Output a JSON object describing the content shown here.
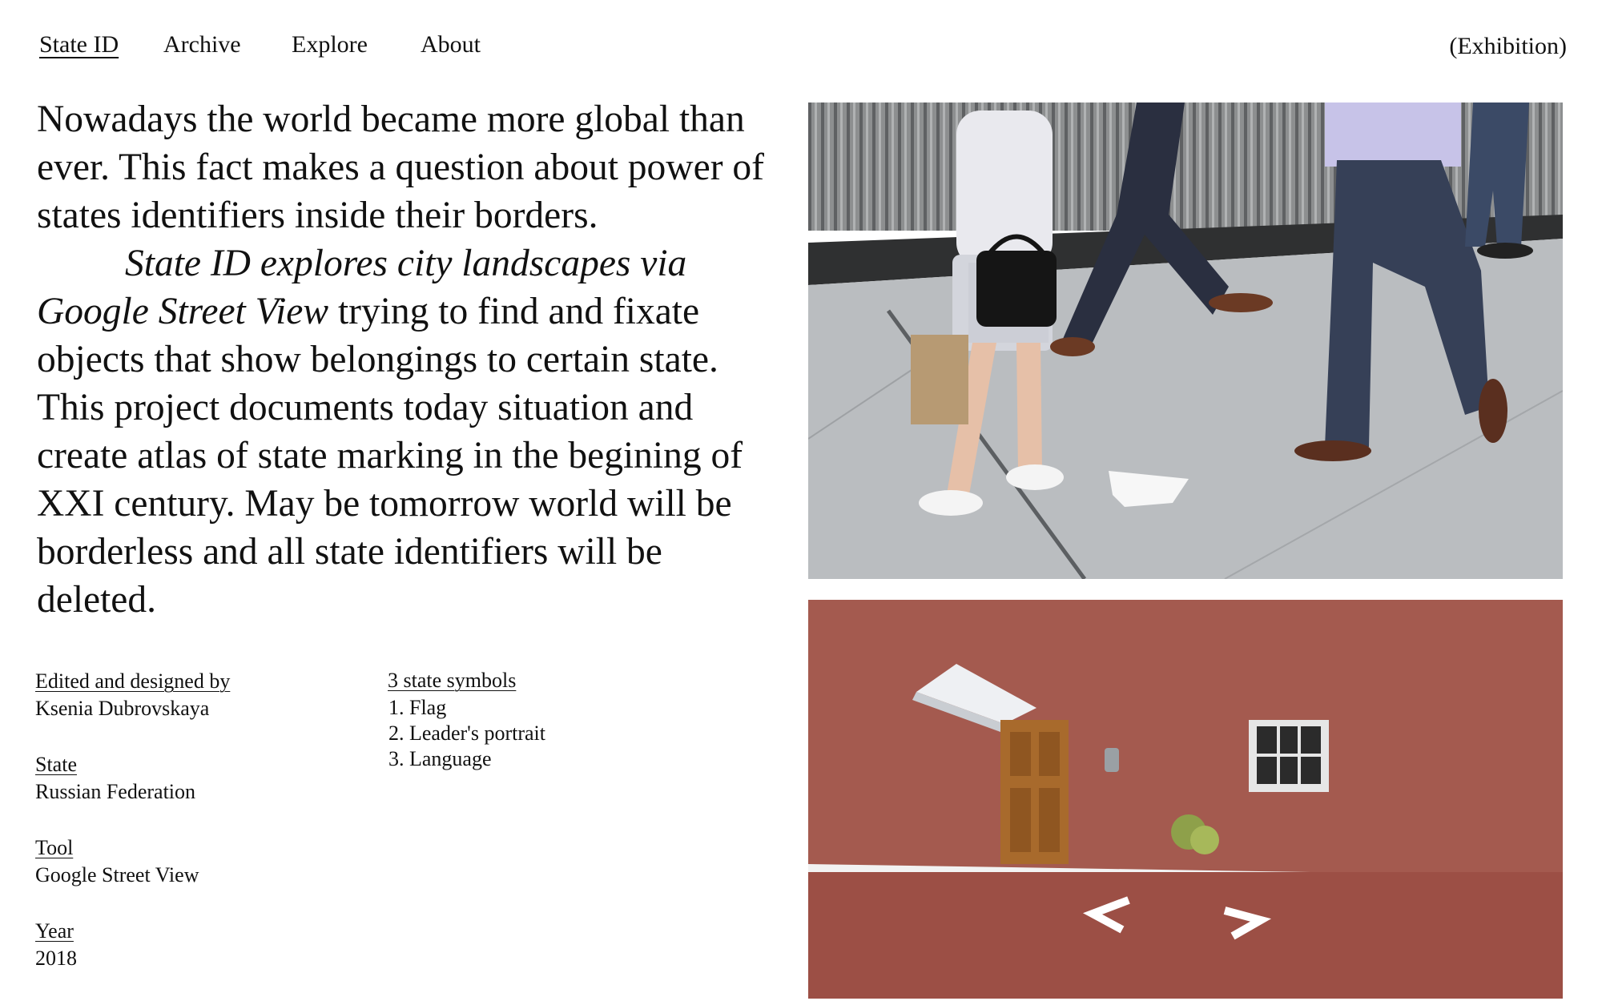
{
  "nav": {
    "items": [
      "State ID",
      "Archive",
      "Explore",
      "About"
    ],
    "exhibition": "(Exhibition)"
  },
  "intro": {
    "paragraph1": "Nowadays the world became more global than ever. This fact makes a question about power of states identifiers inside their borders.",
    "paragraph2_italic": "State ID explores city landscapes via Google Street View",
    "paragraph2_rest": " trying to find and fixate objects that show belongings to certain state. This project documents today situation and create atlas of state marking in the begining of XXI century. May be tomorrow world will be borderless and all state identifiers will be deleted."
  },
  "meta": {
    "editor_label": "Edited and designed by",
    "editor_value": "Ksenia Dubrovskaya",
    "state_label": "State",
    "state_value": "Russian Federation",
    "tool_label": "Tool",
    "tool_value": "Google Street View",
    "year_label": "Year",
    "year_value": "2018"
  },
  "symbols": {
    "label": "3 state symbols",
    "items": [
      "1. Flag",
      "2. Leader's portrait",
      "3. Language"
    ]
  },
  "colors": {
    "text": "#111111",
    "background": "#ffffff",
    "sidewalk": "#b9bcbf",
    "wall": "#a45a4f"
  }
}
